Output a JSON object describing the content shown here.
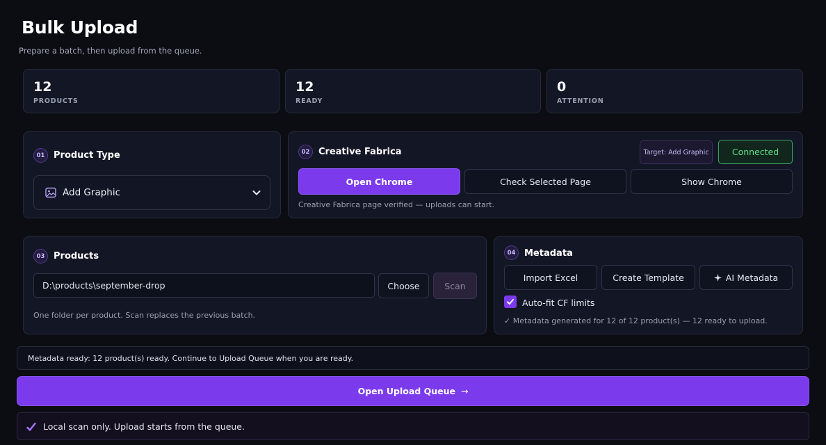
{
  "header": {
    "title": "Bulk Upload",
    "subtitle": "Prepare a batch, then upload from the queue."
  },
  "stats": [
    {
      "value": "12",
      "label": "PRODUCTS"
    },
    {
      "value": "12",
      "label": "READY"
    },
    {
      "value": "0",
      "label": "ATTENTION"
    }
  ],
  "product_type": {
    "step": "01",
    "title": "Product Type",
    "selected": "Add Graphic"
  },
  "creative_fabrica": {
    "step": "02",
    "title": "Creative Fabrica",
    "target_badge": "Target: Add Graphic",
    "status": "Connected",
    "open_chrome_label": "Open Chrome",
    "check_page_label": "Check Selected Page",
    "show_chrome_label": "Show Chrome",
    "status_text": "Creative Fabrica page verified — uploads can start."
  },
  "products": {
    "step": "03",
    "title": "Products",
    "path_value": "D:\\products\\september-drop",
    "choose_label": "Choose",
    "scan_label": "Scan",
    "hint": "One folder per product. Scan replaces the previous batch."
  },
  "metadata": {
    "step": "04",
    "title": "Metadata",
    "import_label": "Import Excel",
    "template_label": "Create Template",
    "ai_label": "AI Metadata",
    "autofit_label": "Auto-fit CF limits",
    "autofit_checked": true,
    "status_text": "✓ Metadata generated for 12 of 12 product(s) — 12 ready to upload."
  },
  "banner": {
    "message": "Metadata ready: 12 product(s) ready. Continue to Upload Queue when you are ready."
  },
  "queue_button": {
    "label": "Open Upload Queue",
    "arrow": "→"
  },
  "footer": {
    "message": "Local scan only. Upload starts from the queue."
  },
  "colors": {
    "accent": "#7c3aed",
    "connected": "#4ade80",
    "background": "#0b0d13"
  },
  "icons": {
    "product_type": "image-icon",
    "dropdown": "chevron-down-icon",
    "ai": "sparkle-icon",
    "checkbox": "check-icon",
    "footer": "check-icon"
  }
}
